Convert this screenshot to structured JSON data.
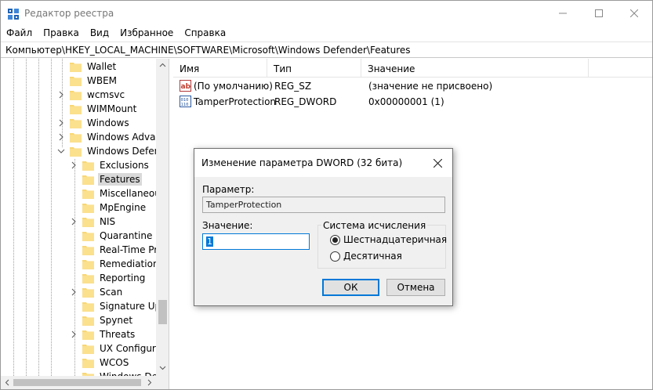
{
  "window": {
    "title": "Редактор реестра"
  },
  "menu": [
    "Файл",
    "Правка",
    "Вид",
    "Избранное",
    "Справка"
  ],
  "address": "Компьютер\\HKEY_LOCAL_MACHINE\\SOFTWARE\\Microsoft\\Windows Defender\\Features",
  "tree": {
    "items": [
      {
        "label": "Wallet"
      },
      {
        "label": "WBEM"
      },
      {
        "label": "wcmsvc"
      },
      {
        "label": "WIMMount"
      },
      {
        "label": "Windows"
      },
      {
        "label": "Windows Advanc"
      },
      {
        "label": "Windows Defend"
      },
      {
        "label": "Exclusions"
      },
      {
        "label": "Features"
      },
      {
        "label": "Miscellaneous"
      },
      {
        "label": "MpEngine"
      },
      {
        "label": "NIS"
      },
      {
        "label": "Quarantine"
      },
      {
        "label": "Real-Time Prot"
      },
      {
        "label": "Remediation"
      },
      {
        "label": "Reporting"
      },
      {
        "label": "Scan"
      },
      {
        "label": "Signature Upd"
      },
      {
        "label": "Spynet"
      },
      {
        "label": "Threats"
      },
      {
        "label": "UX Configurat"
      },
      {
        "label": "WCOS"
      },
      {
        "label": "Windows Defe"
      }
    ]
  },
  "list": {
    "columns": [
      "Имя",
      "Тип",
      "Значение"
    ],
    "rows": [
      {
        "name": "(По умолчанию)",
        "type": "REG_SZ",
        "value": "(значение не присвоено)",
        "icon": "string-value-icon"
      },
      {
        "name": "TamperProtection",
        "type": "REG_DWORD",
        "value": "0x00000001 (1)",
        "icon": "binary-value-icon"
      }
    ]
  },
  "dialog": {
    "title": "Изменение параметра DWORD (32 бита)",
    "param_label": "Параметр:",
    "param_value": "TamperProtection",
    "value_label": "Значение:",
    "value": "1",
    "base_group_label": "Система исчисления",
    "base_options": [
      {
        "label": "Шестнадцатеричная",
        "checked": true
      },
      {
        "label": "Десятичная",
        "checked": false
      }
    ],
    "ok_label": "ОК",
    "cancel_label": "Отмена"
  },
  "colors": {
    "accent": "#0078d7",
    "folder": "#f8d775",
    "selection": "#d9d9d9"
  }
}
